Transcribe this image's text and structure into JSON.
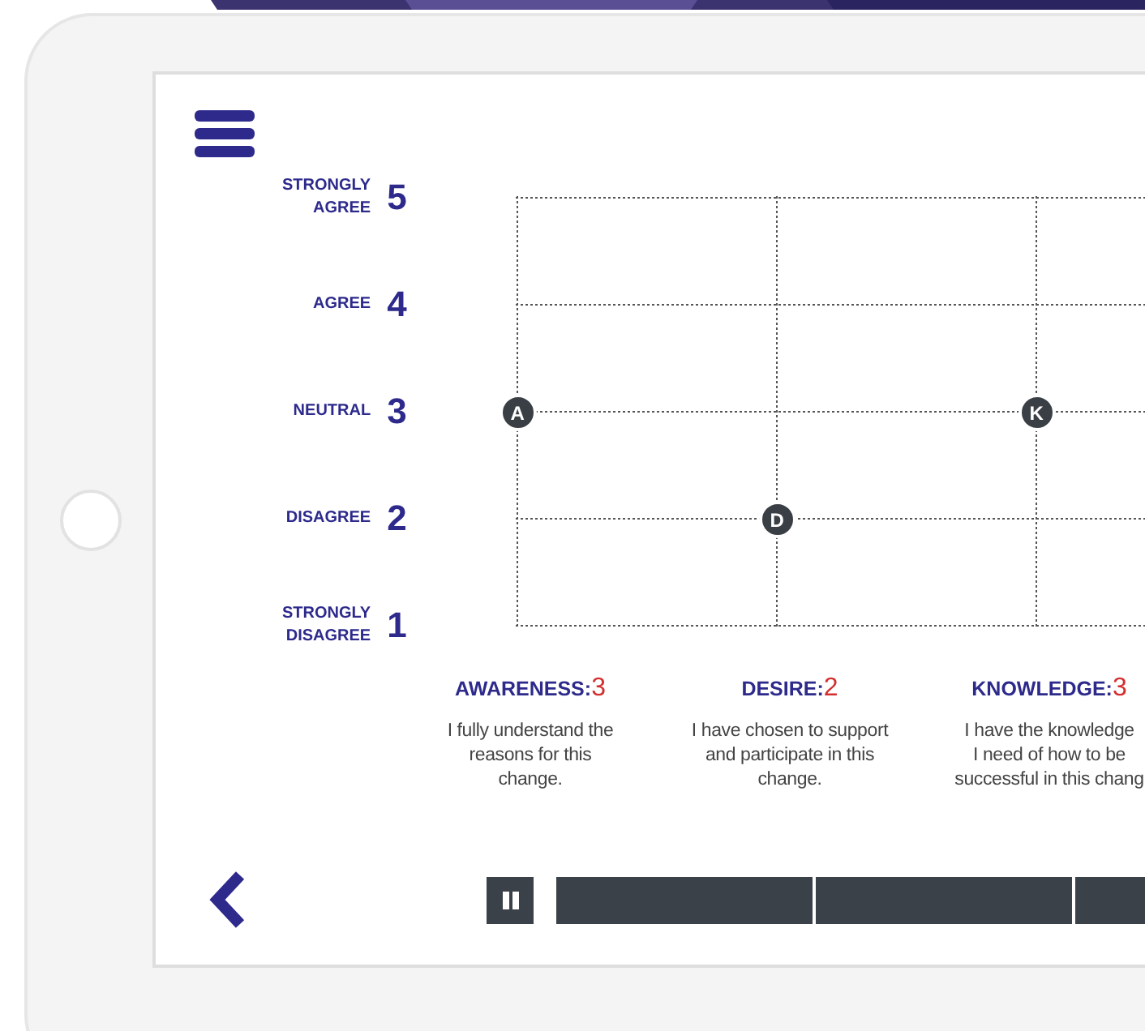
{
  "scale": [
    {
      "label": "STRONGLY AGREE",
      "number": "5"
    },
    {
      "label": "AGREE",
      "number": "4"
    },
    {
      "label": "NEUTRAL",
      "number": "3"
    },
    {
      "label": "DISAGREE",
      "number": "2"
    },
    {
      "label": "STRONGLY DISAGREE",
      "number": "1"
    }
  ],
  "stages": [
    {
      "marker": "A",
      "title": "AWARENESS:",
      "score": "3",
      "description": [
        "I fully understand the",
        "reasons for this",
        "change."
      ]
    },
    {
      "marker": "D",
      "title": "DESIRE:",
      "score": "2",
      "description": [
        "I have chosen to support",
        "and participate in this",
        "change."
      ]
    },
    {
      "marker": "K",
      "title": "KNOWLEDGE:",
      "score": "3",
      "description": [
        "I have the knowledge",
        "I need of how to be",
        "successful in this chang"
      ]
    }
  ]
}
